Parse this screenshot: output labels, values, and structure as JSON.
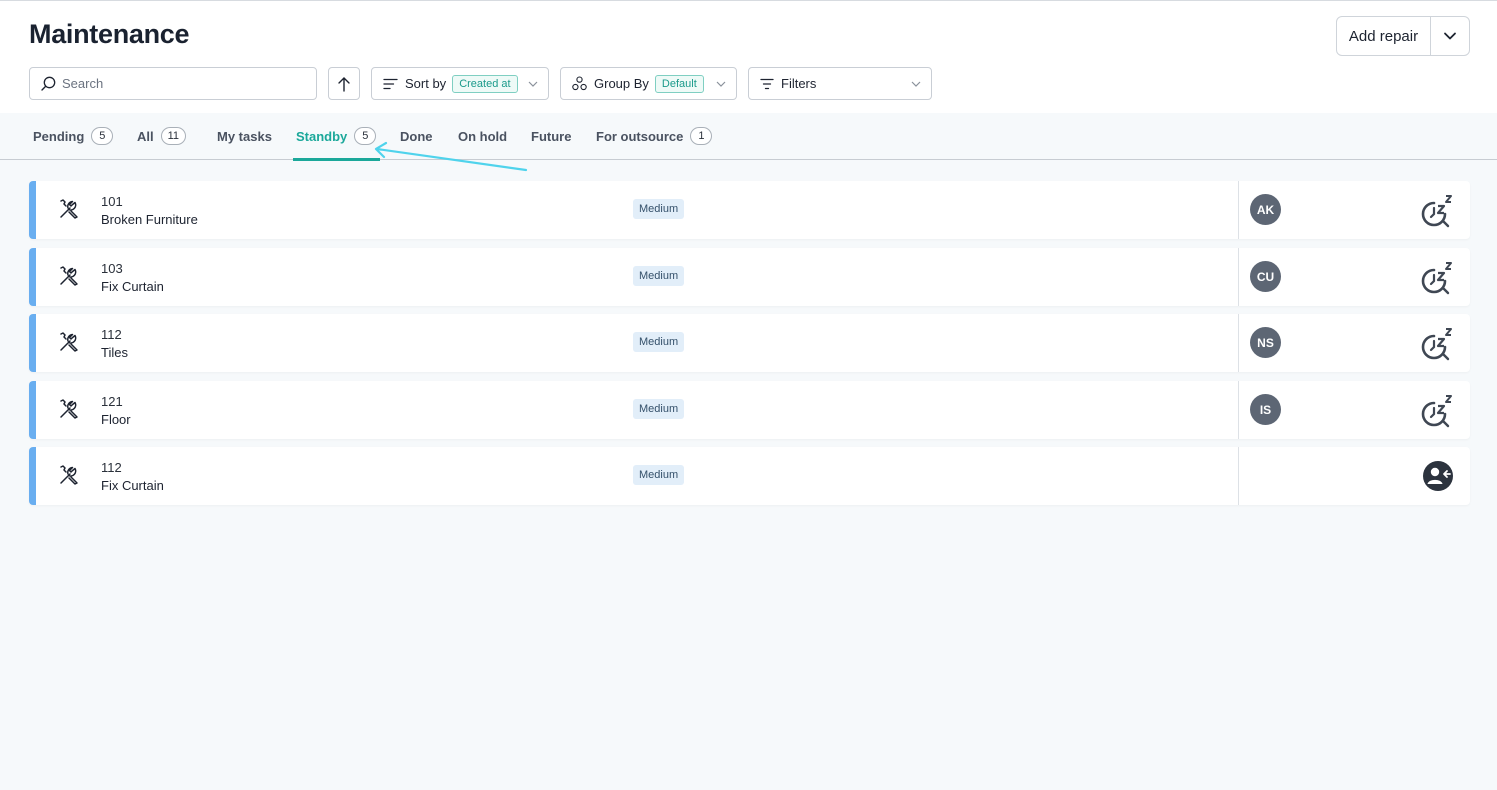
{
  "page": {
    "title": "Maintenance"
  },
  "header": {
    "add_repair_label": "Add repair"
  },
  "toolbar": {
    "search_placeholder": "Search",
    "sort_label": "Sort by",
    "sort_value": "Created at",
    "group_label": "Group By",
    "group_value": "Default",
    "filters_label": "Filters"
  },
  "tabs": [
    {
      "label": "Pending",
      "count": "5"
    },
    {
      "label": "All",
      "count": "11"
    },
    {
      "label": "My tasks",
      "count": null
    },
    {
      "label": "Standby",
      "count": "5",
      "active": true
    },
    {
      "label": "Done",
      "count": null
    },
    {
      "label": "On hold",
      "count": null
    },
    {
      "label": "Future",
      "count": null
    },
    {
      "label": "For outsource",
      "count": "1"
    }
  ],
  "tasks": [
    {
      "number": "101",
      "name": "Broken Furniture",
      "priority": "Medium",
      "assignee": "AK",
      "status_icon": "snooze-clock-icon"
    },
    {
      "number": "103",
      "name": "Fix Curtain",
      "priority": "Medium",
      "assignee": "CU",
      "status_icon": "snooze-clock-icon"
    },
    {
      "number": "112",
      "name": "Tiles",
      "priority": "Medium",
      "assignee": "NS",
      "status_icon": "snooze-clock-icon"
    },
    {
      "number": "121",
      "name": "Floor",
      "priority": "Medium",
      "assignee": "IS",
      "status_icon": "snooze-clock-icon"
    },
    {
      "number": "112",
      "name": "Fix Curtain",
      "priority": "Medium",
      "assignee": "",
      "status_icon": "assign-user-icon"
    }
  ],
  "colors": {
    "accent": "#1ba89a",
    "row_accent": "#69aef0",
    "annotation_arrow": "#4fd3ec",
    "avatar": "#5d6674"
  }
}
